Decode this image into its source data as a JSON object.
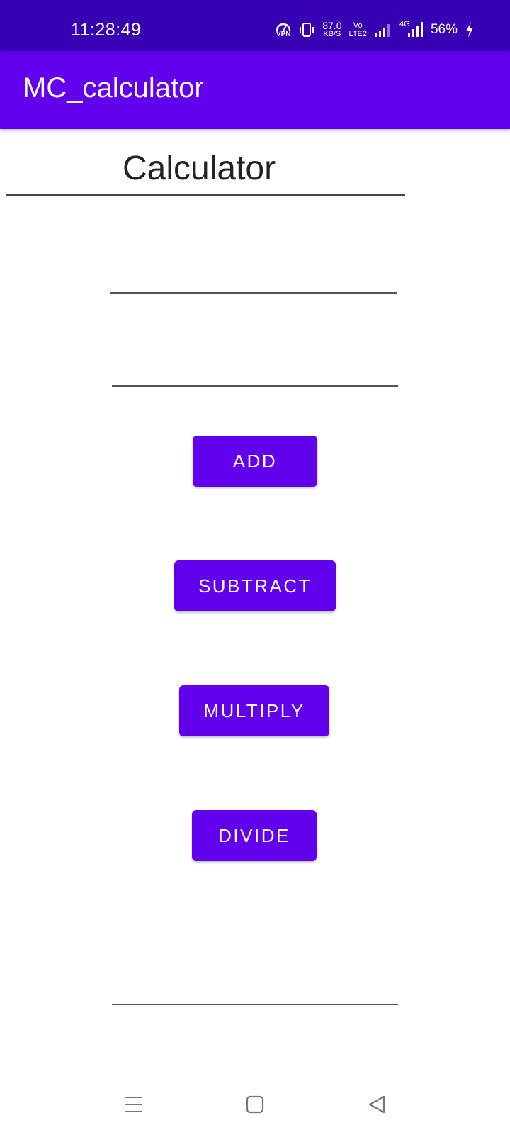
{
  "status_bar": {
    "time": "11:28:49",
    "vpn": "VPN",
    "speed_value": "87.0",
    "speed_unit": "KB/S",
    "volte_top": "Vo",
    "volte_bottom": "LTE2",
    "network": "4G",
    "battery": "56%"
  },
  "app_bar": {
    "title": "MC_calculator"
  },
  "main": {
    "heading": "Calculator",
    "input1_value": "",
    "input2_value": "",
    "result_value": ""
  },
  "buttons": {
    "add": "ADD",
    "subtract": "SUBTRACT",
    "multiply": "MULTIPLY",
    "divide": "DIVIDE"
  },
  "colors": {
    "status_bar": "#3700b3",
    "primary": "#6200ee",
    "background": "#ffffff"
  },
  "icons": {
    "nav_menu": "menu-icon",
    "nav_home": "home-square-icon",
    "nav_back": "back-triangle-icon"
  }
}
